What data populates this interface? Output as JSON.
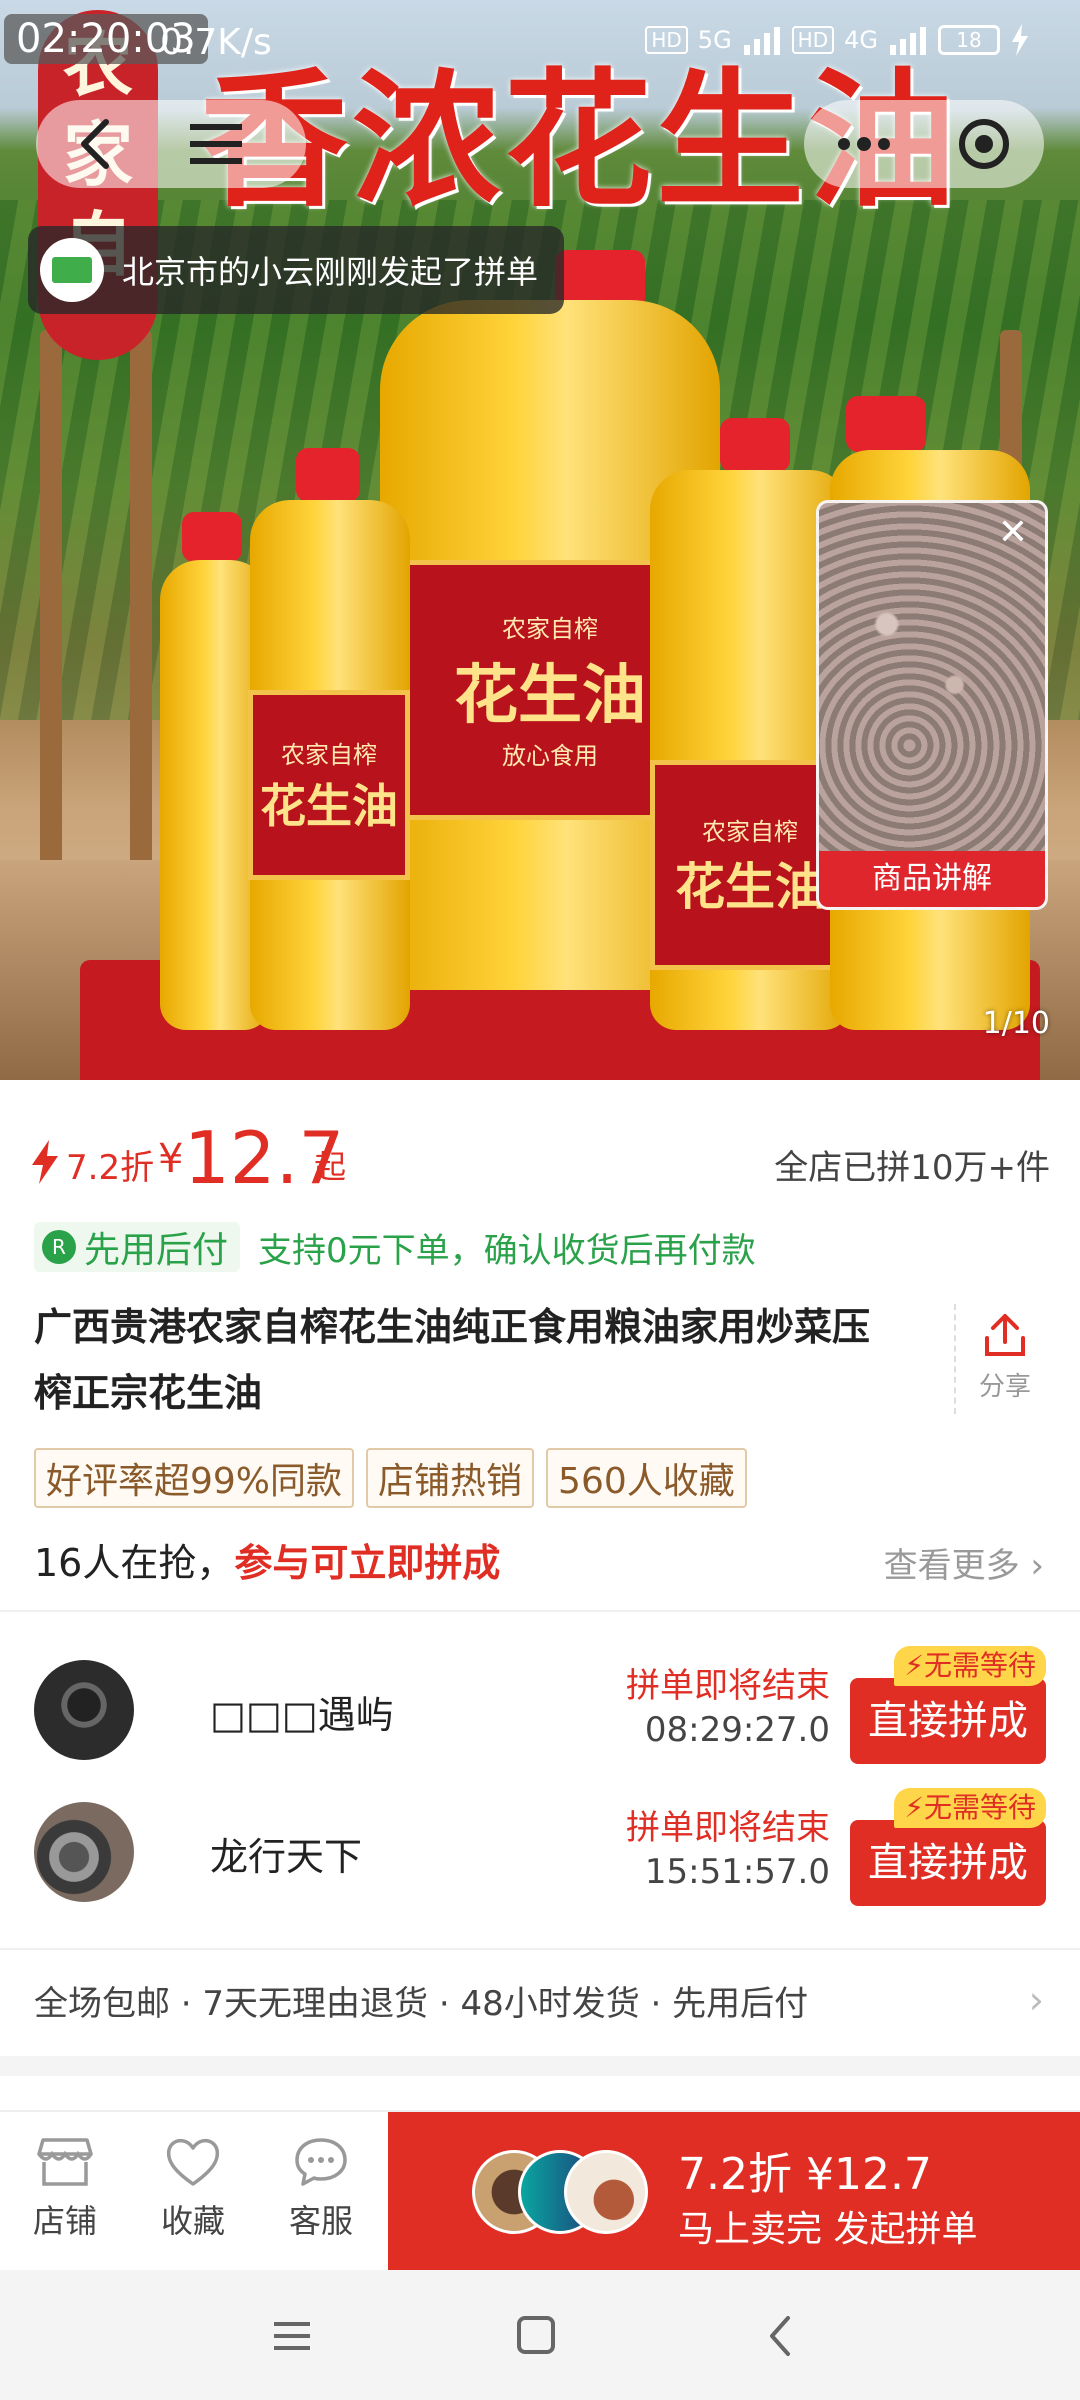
{
  "status_bar": {
    "time": "02:20:03",
    "net_speed": "0.7K/s",
    "network_1": "5G",
    "network_2": "4G",
    "hd_badge": "HD",
    "battery": "18"
  },
  "hero": {
    "headline": "香浓花生油",
    "side_banner": "农家自",
    "bottle_label_top": "农家自榨",
    "bottle_label_main": "花生油",
    "bottle_label_bottom": "放心食用",
    "image_counter": "1/10",
    "video_caption": "商品讲解"
  },
  "toast": {
    "text": "北京市的小云刚刚发起了拼单"
  },
  "price": {
    "discount": "7.2折",
    "currency": "¥",
    "amount": "12.7",
    "suffix": "起",
    "sold_count": "全店已拼10万+件"
  },
  "pay_later": {
    "label": "先用后付",
    "description": "支持0元下单，确认收货后再付款"
  },
  "product": {
    "title": "广西贵港农家自榨花生油纯正食用粮油家用炒菜压榨正宗花生油",
    "share_label": "分享"
  },
  "tags": [
    "好评率超99%同款",
    "店铺热销",
    "560人收藏"
  ],
  "group_header": {
    "count_text": "16人在抢，",
    "highlight": "参与可立即拼成",
    "see_more": "查看更多"
  },
  "groups": [
    {
      "name": "□□□遇屿",
      "status": "拼单即将结束",
      "countdown": "08:29:27.0",
      "badge": "无需等待",
      "button": "直接拼成"
    },
    {
      "name": "龙行天下",
      "status": "拼单即将结束",
      "countdown": "15:51:57.0",
      "badge": "无需等待",
      "button": "直接拼成"
    }
  ],
  "service": {
    "text": "全场包邮 · 7天无理由退货 · 48小时发货 · 先用后付"
  },
  "bottom_bar": {
    "shop": "店铺",
    "favorite": "收藏",
    "service": "客服",
    "buy_price": "7.2折 ¥12.7",
    "buy_sub": "马上卖完 发起拼单"
  },
  "colors": {
    "accent": "#e02e24",
    "pay_green": "#2aa24a",
    "tag_brown": "#8a5a2b"
  }
}
